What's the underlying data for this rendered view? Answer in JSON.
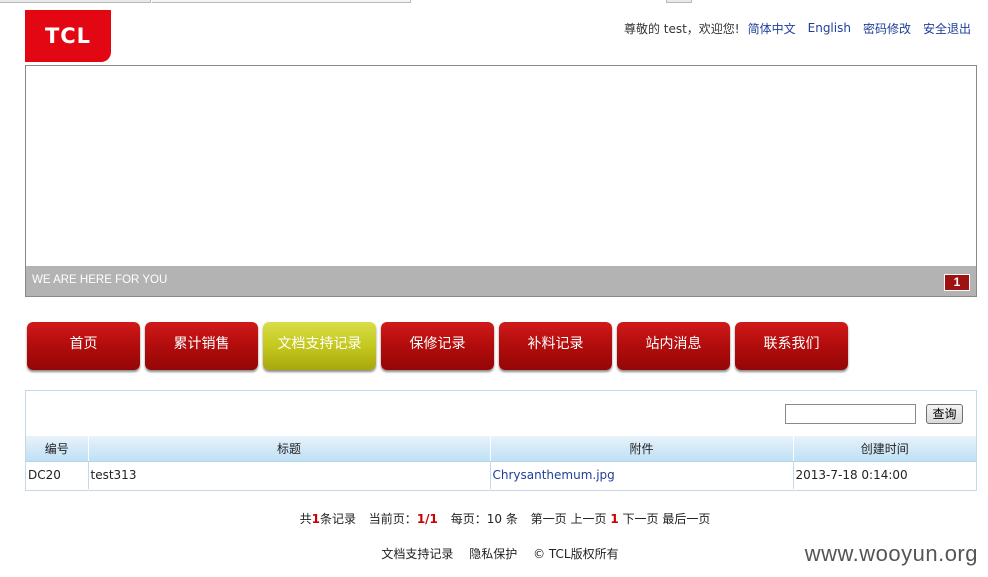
{
  "logo": {
    "text": "TCL",
    "color": "#e30613"
  },
  "top_nav": {
    "greeting": "尊敬的 test，欢迎您!",
    "links": [
      "简体中文",
      "English",
      "密码修改",
      "安全退出"
    ]
  },
  "banner": {
    "caption": "WE ARE HERE FOR YOU",
    "page_indicator": "1"
  },
  "main_nav": {
    "tabs": [
      "首页",
      "累计销售",
      "文档支持记录",
      "保修记录",
      "补料记录",
      "站内消息",
      "联系我们"
    ],
    "active_index": 2,
    "colors": {
      "normal": "#b40d0d",
      "active": "#c4c81e"
    }
  },
  "search": {
    "input_value": "",
    "button_label": "查询"
  },
  "table": {
    "columns": [
      "编号",
      "标题",
      "附件",
      "创建时间"
    ],
    "rows": [
      [
        "DC20",
        "test313",
        "Chrysanthemum.jpg",
        "2013-7-18 0:14:00"
      ]
    ]
  },
  "pagination": {
    "total_prefix": "共",
    "total_count": "1",
    "total_suffix": "条记录",
    "current_label": "当前页：",
    "current_value": "1/1",
    "per_page_label": "每页：",
    "per_page_value": "10 条",
    "first": "第一页",
    "prev": "上一页",
    "page": "1",
    "next": "下一页",
    "last": "最后一页"
  },
  "footer": {
    "links": [
      "文档支持记录",
      "隐私保护"
    ],
    "copyright": "© TCL版权所有"
  },
  "watermark": "www.wooyun.org"
}
